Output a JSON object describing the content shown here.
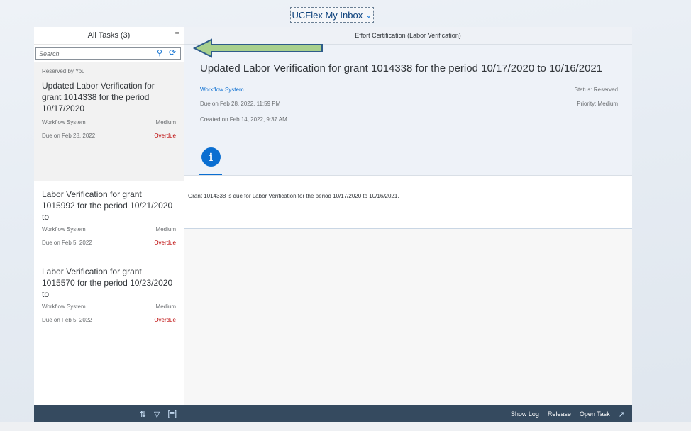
{
  "app": {
    "title": "UCFlex My Inbox"
  },
  "master": {
    "header": "All Tasks (3)",
    "search_placeholder": "Search",
    "tasks": [
      {
        "group": "Reserved by You",
        "title": "Updated Labor Verification for grant 1014338 for the period 10/17/2020",
        "created_by": "Workflow System",
        "priority": "Medium",
        "due": "Due on Feb 28, 2022",
        "status": "Overdue"
      },
      {
        "title": "Labor Verification for grant 1015992 for the period 10/21/2020 to",
        "created_by": "Workflow System",
        "priority": "Medium",
        "due": "Due on Feb 5, 2022",
        "status": "Overdue"
      },
      {
        "title": "Labor Verification for grant 1015570 for the period 10/23/2020 to",
        "created_by": "Workflow System",
        "priority": "Medium",
        "due": "Due on Feb 5, 2022",
        "status": "Overdue"
      }
    ]
  },
  "detail": {
    "nav_title": "Effort Certification (Labor Verification)",
    "title": "Updated Labor Verification for grant 1014338 for the period 10/17/2020 to 10/16/2021",
    "created_by": "Workflow System",
    "due": "Due on Feb 28, 2022, 11:59 PM",
    "created": "Created on Feb 14, 2022, 9:37 AM",
    "status": "Status: Reserved",
    "priority": "Priority: Medium",
    "info_tab_icon": "i",
    "description": "Grant 1014338 is due for Labor Verification for the period 10/17/2020 to 10/16/2021."
  },
  "footer": {
    "show_log": "Show Log",
    "release": "Release",
    "open_task": "Open Task"
  },
  "colors": {
    "accent": "#0a6ed1",
    "footer": "#354a5f",
    "overdue": "#bb0000",
    "arrow_fill": "#a8d08d",
    "arrow_stroke": "#2e5c8a"
  }
}
